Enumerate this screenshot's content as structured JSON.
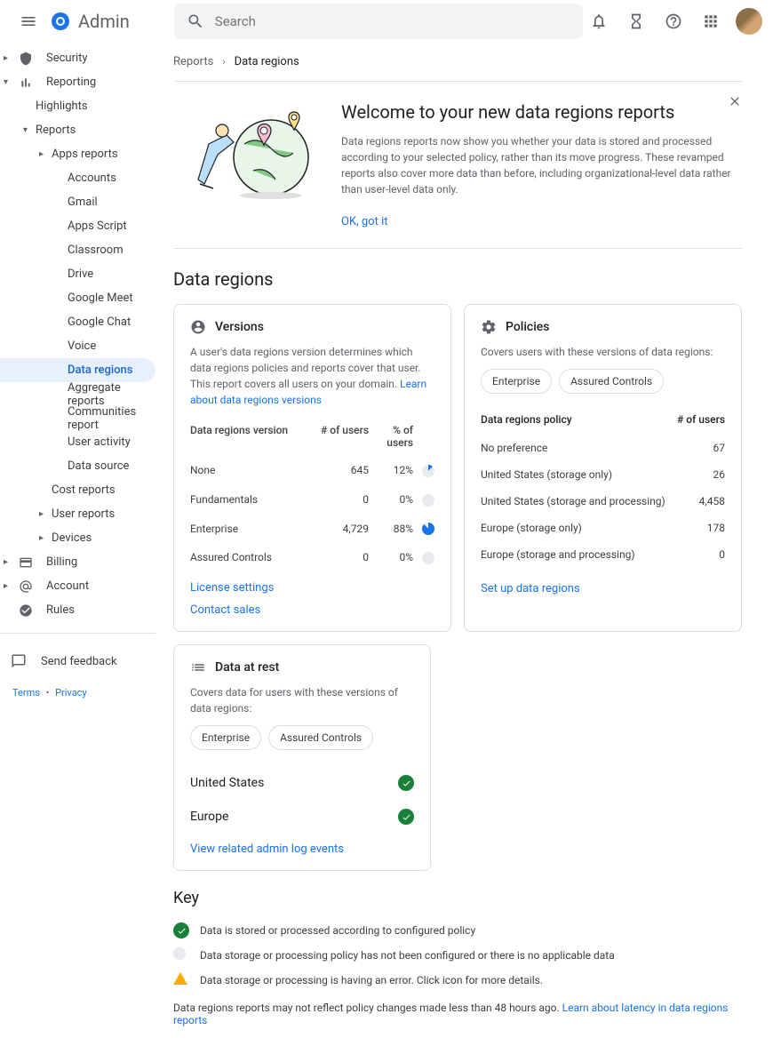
{
  "header": {
    "app_name": "Admin",
    "search_placeholder": "Search"
  },
  "sidebar": {
    "items": [
      {
        "label": "Security",
        "level": "l1",
        "icon": "shield",
        "arrow": "▸"
      },
      {
        "label": "Reporting",
        "level": "l1",
        "icon": "chart",
        "arrow": "▾"
      },
      {
        "label": "Highlights",
        "level": "l2"
      },
      {
        "label": "Reports",
        "level": "l2",
        "arrow": "▾"
      },
      {
        "label": "Apps reports",
        "level": "l3",
        "arrow": "▸"
      },
      {
        "label": "Accounts",
        "level": "l4"
      },
      {
        "label": "Gmail",
        "level": "l4"
      },
      {
        "label": "Apps Script",
        "level": "l4"
      },
      {
        "label": "Classroom",
        "level": "l4"
      },
      {
        "label": "Drive",
        "level": "l4"
      },
      {
        "label": "Google Meet",
        "level": "l4"
      },
      {
        "label": "Google Chat",
        "level": "l4"
      },
      {
        "label": "Voice",
        "level": "l4"
      },
      {
        "label": "Data regions",
        "level": "l4",
        "active": true
      },
      {
        "label": "Aggregate reports",
        "level": "l4"
      },
      {
        "label": "Communities report",
        "level": "l4"
      },
      {
        "label": "User activity",
        "level": "l4"
      },
      {
        "label": "Data source",
        "level": "l4"
      },
      {
        "label": "Cost reports",
        "level": "l3"
      },
      {
        "label": "User reports",
        "level": "l3",
        "arrow": "▸"
      },
      {
        "label": "Devices",
        "level": "l3",
        "arrow": "▸"
      },
      {
        "label": "Billing",
        "level": "l1",
        "icon": "card",
        "arrow": "▸"
      },
      {
        "label": "Account",
        "level": "l1",
        "icon": "at",
        "arrow": "▸"
      },
      {
        "label": "Rules",
        "level": "l1",
        "icon": "rules"
      }
    ],
    "feedback": "Send feedback",
    "terms": "Terms",
    "privacy": "Privacy"
  },
  "breadcrumb": {
    "parent": "Reports",
    "current": "Data regions"
  },
  "welcome": {
    "title": "Welcome to your new data regions reports",
    "text": "Data regions reports now show you whether your data is stored and processed according to your selected policy, rather than its move progress. These revamped reports also cover more data than before, including organizational-level data rather than user-level data only.",
    "ok": "OK, got it"
  },
  "page_title": "Data regions",
  "versions": {
    "title": "Versions",
    "desc": "A user's data regions version determines which data regions policies and reports cover that user. This report covers all users on your domain.",
    "learn_link": "Learn about data regions versions",
    "th_version": "Data regions version",
    "th_users": "# of users",
    "th_pct": "% of users",
    "rows": [
      {
        "label": "None",
        "users": "645",
        "pct": "12%"
      },
      {
        "label": "Fundamentals",
        "users": "0",
        "pct": "0%"
      },
      {
        "label": "Enterprise",
        "users": "4,729",
        "pct": "88%"
      },
      {
        "label": "Assured Controls",
        "users": "0",
        "pct": "0%"
      }
    ],
    "link1": "License settings",
    "link2": "Contact sales"
  },
  "policies": {
    "title": "Policies",
    "desc": "Covers users with these versions of data regions:",
    "chips": [
      "Enterprise",
      "Assured Controls"
    ],
    "th_policy": "Data regions policy",
    "th_users": "# of users",
    "rows": [
      {
        "label": "No preference",
        "users": "67"
      },
      {
        "label": "United States (storage only)",
        "users": "26"
      },
      {
        "label": "United States (storage and processing)",
        "users": "4,458"
      },
      {
        "label": "Europe (storage only)",
        "users": "178"
      },
      {
        "label": "Europe (storage and processing)",
        "users": "0"
      }
    ],
    "link": "Set up data regions"
  },
  "rest": {
    "title": "Data at rest",
    "desc": "Covers data for users with these versions of data regions:",
    "chips": [
      "Enterprise",
      "Assured Controls"
    ],
    "rows": [
      "United States",
      "Europe"
    ],
    "link": "View related admin log events"
  },
  "key": {
    "title": "Key",
    "items": [
      "Data is stored or processed according to configured policy",
      "Data storage or processing policy has not been configured or there is no applicable data",
      "Data storage or processing is having an error. Click icon for more details."
    ],
    "note": "Data regions reports may not reflect policy changes made less than 48 hours ago.",
    "note_link": "Learn about latency in data regions reports"
  }
}
